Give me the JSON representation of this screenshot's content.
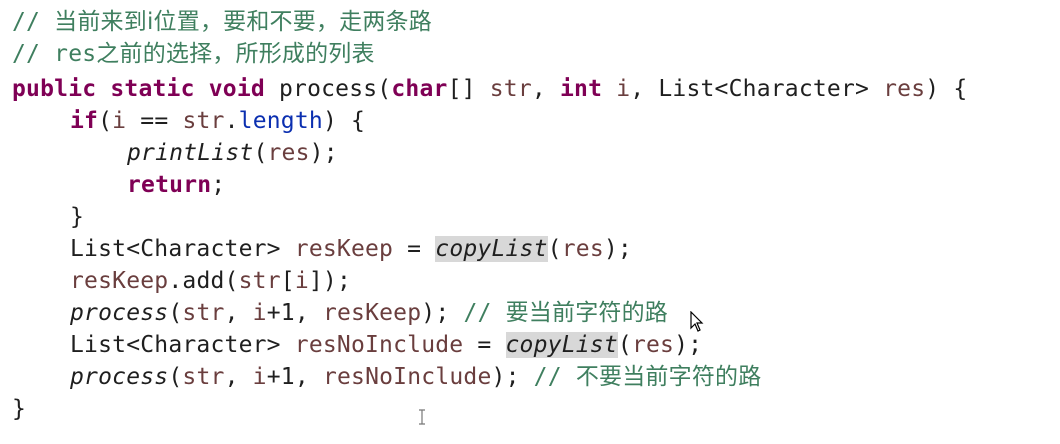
{
  "editor": {
    "lines": [
      {
        "segments": [
          {
            "t": "// ",
            "c": "comment"
          },
          {
            "t": "当前来到i位置，要和不要，走两条路",
            "c": "comment-cn"
          }
        ]
      },
      {
        "segments": [
          {
            "t": "// res",
            "c": "comment"
          },
          {
            "t": "之前的选择，所形成的列表",
            "c": "comment-cn"
          }
        ]
      },
      {
        "segments": [
          {
            "t": "public",
            "c": "kw"
          },
          {
            "t": " "
          },
          {
            "t": "static",
            "c": "kw"
          },
          {
            "t": " "
          },
          {
            "t": "void",
            "c": "kw"
          },
          {
            "t": " process("
          },
          {
            "t": "char",
            "c": "kw"
          },
          {
            "t": "[] "
          },
          {
            "t": "str",
            "c": "var"
          },
          {
            "t": ", "
          },
          {
            "t": "int",
            "c": "kw"
          },
          {
            "t": " "
          },
          {
            "t": "i",
            "c": "var"
          },
          {
            "t": ", List<Character> "
          },
          {
            "t": "res",
            "c": "var"
          },
          {
            "t": ") {"
          }
        ]
      },
      {
        "indent": 1,
        "segments": [
          {
            "t": "if",
            "c": "kw"
          },
          {
            "t": "("
          },
          {
            "t": "i",
            "c": "var"
          },
          {
            "t": " == "
          },
          {
            "t": "str",
            "c": "var"
          },
          {
            "t": "."
          },
          {
            "t": "length",
            "c": "field"
          },
          {
            "t": ") {"
          }
        ]
      },
      {
        "indent": 2,
        "segments": [
          {
            "t": "printList",
            "c": "ital"
          },
          {
            "t": "("
          },
          {
            "t": "res",
            "c": "var"
          },
          {
            "t": ");"
          }
        ]
      },
      {
        "indent": 2,
        "segments": [
          {
            "t": "return",
            "c": "kw"
          },
          {
            "t": ";"
          }
        ]
      },
      {
        "indent": 1,
        "segments": [
          {
            "t": "}"
          }
        ]
      },
      {
        "indent": 1,
        "segments": [
          {
            "t": "List<Character> "
          },
          {
            "t": "resKeep",
            "c": "var"
          },
          {
            "t": " = "
          },
          {
            "t": "copyList",
            "c": "ital hl"
          },
          {
            "t": "("
          },
          {
            "t": "res",
            "c": "var"
          },
          {
            "t": ");"
          }
        ]
      },
      {
        "indent": 1,
        "segments": [
          {
            "t": "resKeep",
            "c": "var"
          },
          {
            "t": ".add("
          },
          {
            "t": "str",
            "c": "var"
          },
          {
            "t": "["
          },
          {
            "t": "i",
            "c": "var"
          },
          {
            "t": "]);"
          }
        ]
      },
      {
        "indent": 1,
        "segments": [
          {
            "t": "process",
            "c": "ital"
          },
          {
            "t": "("
          },
          {
            "t": "str",
            "c": "var"
          },
          {
            "t": ", "
          },
          {
            "t": "i",
            "c": "var"
          },
          {
            "t": "+1, "
          },
          {
            "t": "resKeep",
            "c": "var"
          },
          {
            "t": "); "
          },
          {
            "t": "// ",
            "c": "comment"
          },
          {
            "t": "要当前字符的路",
            "c": "comment-cn"
          }
        ]
      },
      {
        "indent": 1,
        "segments": [
          {
            "t": "List<Character> "
          },
          {
            "t": "resNoInclude",
            "c": "var"
          },
          {
            "t": " = "
          },
          {
            "t": "copyList",
            "c": "ital hl"
          },
          {
            "t": "("
          },
          {
            "t": "res",
            "c": "var"
          },
          {
            "t": ");"
          }
        ]
      },
      {
        "indent": 1,
        "segments": [
          {
            "t": "process",
            "c": "ital"
          },
          {
            "t": "("
          },
          {
            "t": "str",
            "c": "var"
          },
          {
            "t": ", "
          },
          {
            "t": "i",
            "c": "var"
          },
          {
            "t": "+1, "
          },
          {
            "t": "resNoInclude",
            "c": "var"
          },
          {
            "t": "); "
          },
          {
            "t": "// ",
            "c": "comment"
          },
          {
            "t": "不要当前字符的路",
            "c": "comment-cn"
          }
        ]
      },
      {
        "segments": [
          {
            "t": "}"
          }
        ]
      }
    ]
  },
  "icons": {
    "mouse_cursor": "arrow-cursor-icon",
    "text_cursor": "ibeam-cursor-icon"
  },
  "colors": {
    "keyword": "#7f0055",
    "comment": "#3f7f5f",
    "field": "#0b2fb0",
    "variable": "#6a3e3e",
    "highlight": "#d8d8d8"
  }
}
